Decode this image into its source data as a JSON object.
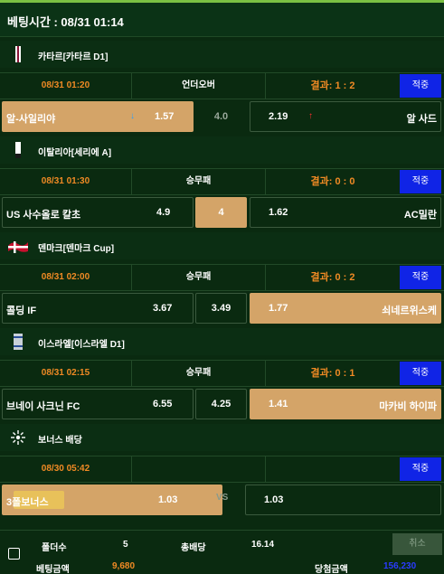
{
  "header": {
    "betting_time_label": "베팅시간 : 08/31 01:14"
  },
  "matches": [
    {
      "league": "카타르[카타르 D1]",
      "time": "08/31 01:20",
      "bet_type": "언더오버",
      "result": "결과: 1 : 2",
      "apply": "적중",
      "home": "알-사일리야",
      "home_odds": "1.57",
      "draw": "4.0",
      "away_odds": "2.19",
      "away": "알 사드"
    },
    {
      "league": "이탈리아[세리에 A]",
      "time": "08/31 01:30",
      "bet_type": "승무패",
      "result": "결과: 0 : 0",
      "apply": "적중",
      "home": "US 사수올로 칼초",
      "home_odds": "4.9",
      "draw": "4",
      "away_odds": "1.62",
      "away": "AC밀란"
    },
    {
      "league": "덴마크[덴마크 Cup]",
      "time": "08/31 02:00",
      "bet_type": "승무패",
      "result": "결과: 0 : 2",
      "apply": "적중",
      "home": "콜딩 IF",
      "home_odds": "3.67",
      "draw": "3.49",
      "away_odds": "1.77",
      "away": "쇠네르위스케"
    },
    {
      "league": "이스라엘[이스라엘 D1]",
      "time": "08/31 02:15",
      "bet_type": "승무패",
      "result": "결과: 0 : 1",
      "apply": "적중",
      "home": "브네이 사크닌 FC",
      "home_odds": "6.55",
      "draw": "4.25",
      "away_odds": "1.41",
      "away": "마카비 하이파"
    }
  ],
  "bonus": {
    "league": "보너스 배당",
    "time": "08/30 05:42",
    "apply": "적중",
    "home": "3폴보너스",
    "home_odds": "1.03",
    "vs": "VS",
    "away_odds": "1.03"
  },
  "footer": {
    "folder_label": "폴더수",
    "folder_value": "5",
    "total_odds_label": "총배당",
    "total_odds_value": "16.14",
    "bet_amount_label": "베팅금액",
    "bet_amount_value": "9,680",
    "win_amount_label": "당첨금액",
    "win_amount_value": "156,230",
    "cancel_label": "취소"
  },
  "colors": {
    "accent_orange": "#f08a24",
    "selected_tan": "#d4a468",
    "apply_blue": "#1024e6",
    "win_blue": "#2a3bff"
  },
  "icons": [
    "qatar-flag-icon",
    "italy-flag-icon",
    "denmark-flag-icon",
    "israel-flag-icon",
    "bonus-sparkle-icon",
    "odds-up-arrow-icon",
    "odds-down-arrow-icon"
  ]
}
